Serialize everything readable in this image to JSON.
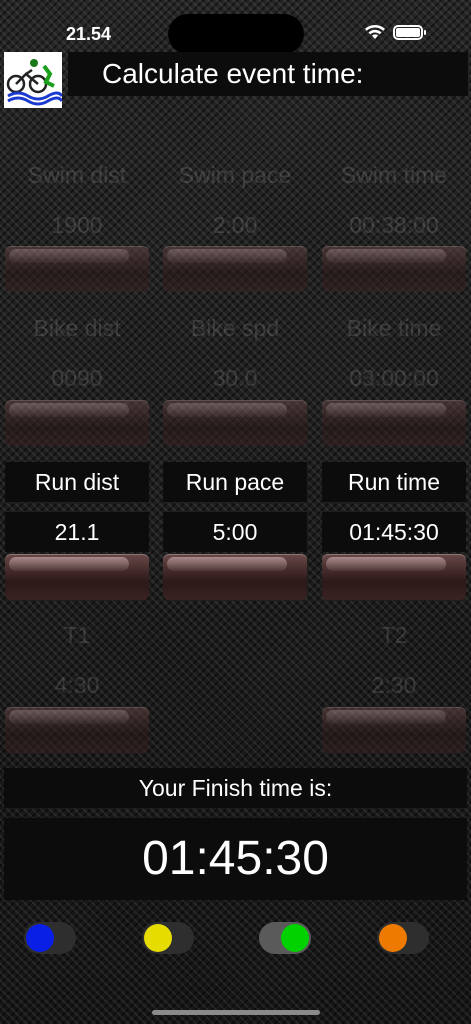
{
  "status_bar": {
    "time": "21.54"
  },
  "header": {
    "title": "Calculate event time:",
    "logo_icon": "triathlon-logo-icon"
  },
  "swim": {
    "dist_label": "Swim dist",
    "pace_label": "Swim pace",
    "time_label": "Swim time",
    "dist": "1900",
    "pace": "2:00",
    "time": "00:38:00"
  },
  "bike": {
    "dist_label": "Bike dist",
    "pace_label": "Bike spd",
    "time_label": "Bike time",
    "dist": "0090",
    "pace": "30.0",
    "time": "03:00:00"
  },
  "run": {
    "dist_label": "Run dist",
    "pace_label": "Run pace",
    "time_label": "Run time",
    "dist": "21.1",
    "pace": "5:00",
    "time": "01:45:30"
  },
  "transitions": {
    "t1_label": "T1",
    "t1": "4:30",
    "t2_label": "T2",
    "t2": "2:30"
  },
  "finish": {
    "label": "Your Finish time is:",
    "time": "01:45:30"
  },
  "toggles": [
    {
      "color": "#0a1fe6",
      "on": false
    },
    {
      "color": "#e6dc00",
      "on": false
    },
    {
      "color": "#00d200",
      "on": true
    },
    {
      "color": "#ee7a00",
      "on": false
    }
  ],
  "colors": {
    "active_panel": "#0c0c0c",
    "button": "#4a2f2f"
  }
}
